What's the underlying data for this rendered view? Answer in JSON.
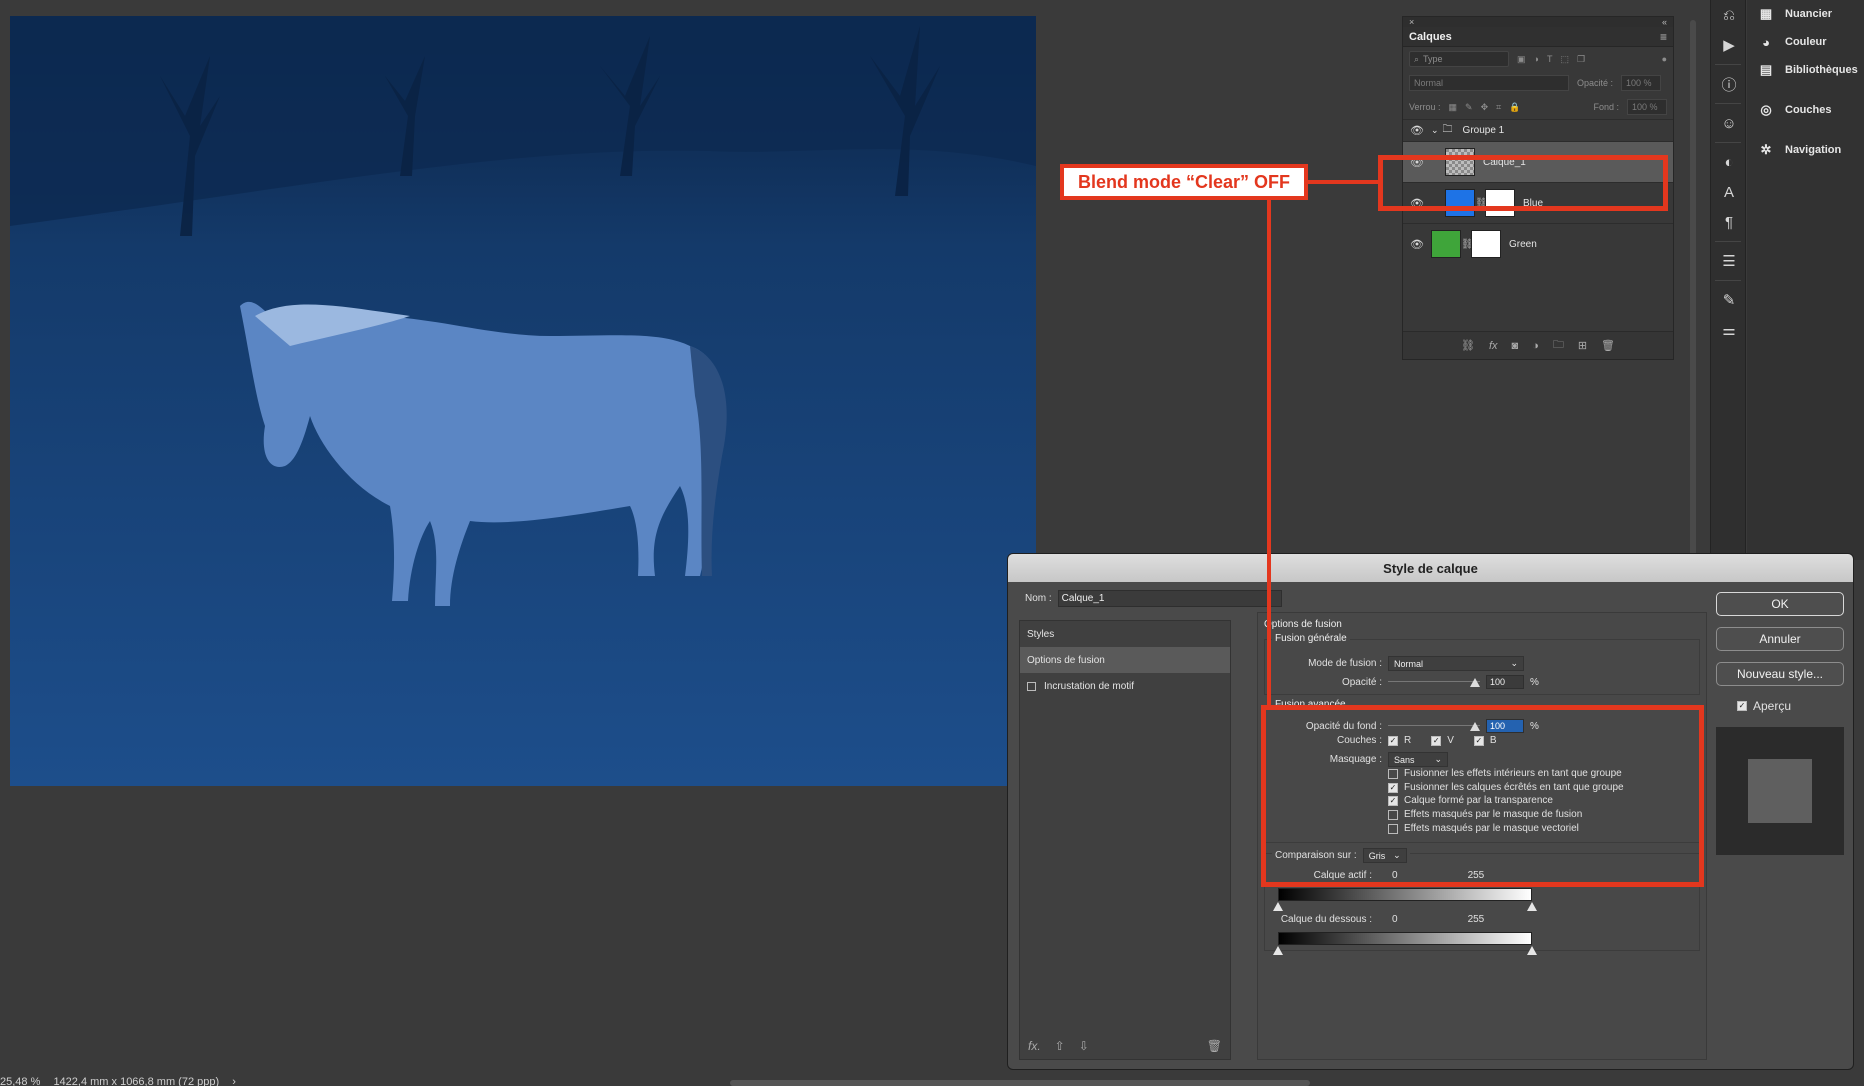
{
  "canvas": {
    "tint": "#123a6b"
  },
  "status_bar": {
    "zoom": "25,48 %",
    "doc_size": "1422,4 mm x 1066,8 mm (72 ppp)",
    "arrow": "›"
  },
  "tool_strip": {
    "icons": [
      "history-icon",
      "play-icon",
      "info-icon",
      "person-icon",
      "adjustments-icon",
      "character-icon",
      "paragraph-icon",
      "properties-icon",
      "brush-icon",
      "brush-settings-icon"
    ]
  },
  "panel_dock": {
    "items": [
      {
        "label": "Nuancier",
        "icon": "▦"
      },
      {
        "label": "Couleur",
        "icon": "◕"
      },
      {
        "label": "Bibliothèques",
        "icon": "▤"
      },
      {
        "label": "Couches",
        "icon": "◎"
      },
      {
        "label": "Navigation",
        "icon": "✲"
      }
    ]
  },
  "layers_panel": {
    "close_glyph": "×",
    "collapse_glyph": "«",
    "tab": "Calques",
    "menu_glyph": "≡",
    "filter_placeholder": "Type",
    "blend_mode": "Normal",
    "opacity_label": "Opacité :",
    "opacity_value": "100 %",
    "lock_label": "Verrou :",
    "fill_label": "Fond :",
    "fill_value": "100 %",
    "group_name": "Groupe 1",
    "layers": [
      {
        "name": "Calque_1",
        "thumb_color": "#9a9a9a"
      },
      {
        "name": "Blue",
        "thumb_color": "#1e73e6"
      },
      {
        "name": "Green",
        "thumb_color": "#3fa53a"
      }
    ],
    "footer_icons": [
      "link-icon",
      "fx-icon",
      "mask-icon",
      "adjustment-icon",
      "folder-icon",
      "new-layer-icon",
      "trash-icon"
    ]
  },
  "annotation": {
    "label": "Blend mode “Clear” OFF",
    "color": "#e3371e"
  },
  "dialog": {
    "title": "Style de calque",
    "name_label": "Nom :",
    "name_value": "Calque_1",
    "styles_header": "Styles",
    "styles_items": [
      {
        "label": "Options de fusion",
        "active": true
      },
      {
        "label": "Incrustation de motif",
        "active": false,
        "checked": false
      }
    ],
    "footer": {
      "fx": "fx.",
      "up": "⇧",
      "down": "⇩",
      "trash": "🗑"
    },
    "options_title": "Options de fusion",
    "general": {
      "title": "Fusion générale",
      "mode_label": "Mode de fusion :",
      "mode_value": "Normal",
      "opacity_label": "Opacité :",
      "opacity_value": "100",
      "opacity_fraction": 1.0,
      "percent": "%"
    },
    "advanced": {
      "title": "Fusion avancée",
      "fill_label": "Opacité du fond :",
      "fill_value": "100",
      "fill_fraction": 1.0,
      "percent": "%",
      "channels_label": "Couches :",
      "channels": [
        {
          "label": "R",
          "checked": true
        },
        {
          "label": "V",
          "checked": true
        },
        {
          "label": "B",
          "checked": true
        }
      ],
      "knockout_label": "Masquage :",
      "knockout_value": "Sans",
      "options": [
        {
          "label": "Fusionner les effets intérieurs en tant que groupe",
          "checked": false
        },
        {
          "label": "Fusionner les calques écrêtés en tant que groupe",
          "checked": true
        },
        {
          "label": "Calque formé par la transparence",
          "checked": true
        },
        {
          "label": "Effets masqués par le masque de fusion",
          "checked": false
        },
        {
          "label": "Effets masqués par le masque vectoriel",
          "checked": false
        }
      ]
    },
    "blend_if": {
      "label": "Comparaison sur :",
      "value": "Gris",
      "this_layer_label": "Calque actif :",
      "this_min": "0",
      "this_max": "255",
      "underlying_label": "Calque du dessous :",
      "under_min": "0",
      "under_max": "255"
    },
    "buttons": {
      "ok": "OK",
      "cancel": "Annuler",
      "new_style": "Nouveau style..."
    },
    "preview_label": "Aperçu",
    "preview_checked": true
  }
}
